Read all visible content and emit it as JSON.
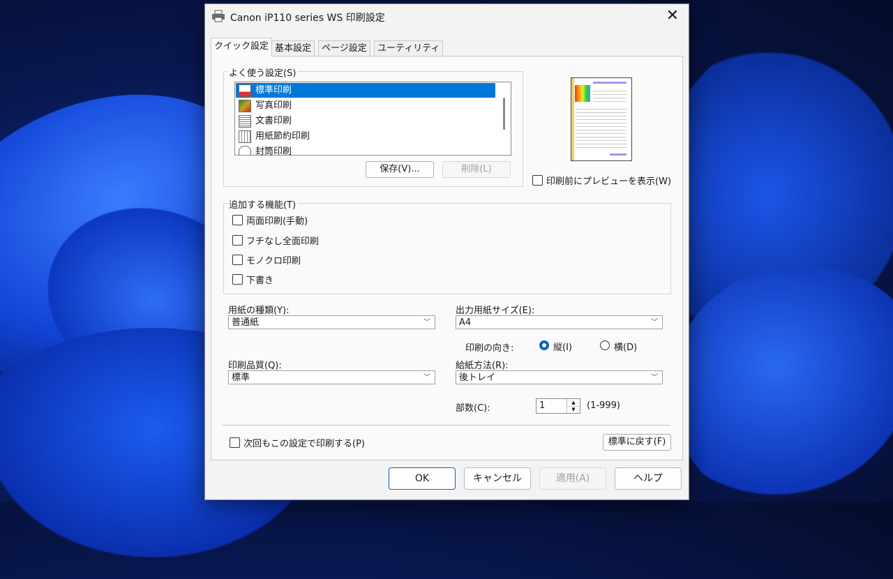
{
  "window": {
    "title": "Canon iP110 series WS 印刷設定",
    "close_glyph": "✕"
  },
  "tabs": [
    "クイック設定",
    "基本設定",
    "ページ設定",
    "ユーティリティ"
  ],
  "favorites": {
    "label": "よく使う設定(S)",
    "items": [
      "標準印刷",
      "写真印刷",
      "文書印刷",
      "用紙節約印刷",
      "封筒印刷"
    ],
    "selected_index": 0,
    "save_button": "保存(V)...",
    "delete_button": "削除(L)"
  },
  "preview": {
    "checkbox_label": "印刷前にプレビューを表示(W)",
    "checked": false
  },
  "features": {
    "label": "追加する機能(T)",
    "items": [
      {
        "label": "両面印刷(手動)",
        "checked": false
      },
      {
        "label": "フチなし全面印刷",
        "checked": false
      },
      {
        "label": "モノクロ印刷",
        "checked": false
      },
      {
        "label": "下書き",
        "checked": false
      }
    ]
  },
  "media_type": {
    "label": "用紙の種類(Y):",
    "value": "普通紙"
  },
  "output_size": {
    "label": "出力用紙サイズ(E):",
    "value": "A4"
  },
  "orientation": {
    "label": "印刷の向き:",
    "portrait": "縦(I)",
    "landscape": "横(D)",
    "selected": "portrait"
  },
  "quality": {
    "label": "印刷品質(Q):",
    "value": "標準"
  },
  "paper_source": {
    "label": "給紙方法(R):",
    "value": "後トレイ"
  },
  "copies": {
    "label": "部数(C):",
    "value": "1",
    "range": "(1-999)"
  },
  "always_print": {
    "label": "次回もこの設定で印刷する(P)",
    "checked": false
  },
  "defaults_button": "標準に戻す(F)",
  "footer": {
    "ok": "OK",
    "cancel": "キャンセル",
    "apply": "適用(A)",
    "help": "ヘルプ"
  },
  "colors": {
    "accent": "#0078d7",
    "dialog_bg": "#f3f3f3",
    "wallpaper": "#0f2f9a"
  },
  "icons": {
    "title": "printer-icon",
    "chevron": "chevron-down-icon"
  }
}
